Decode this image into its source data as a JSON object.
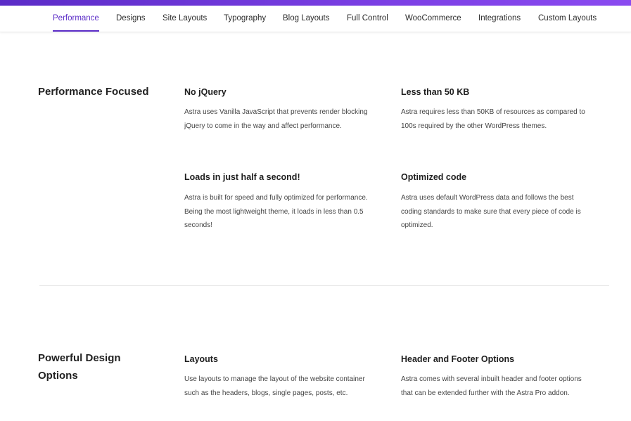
{
  "nav": {
    "tabs": [
      {
        "label": "Performance",
        "active": true
      },
      {
        "label": "Designs"
      },
      {
        "label": "Site Layouts"
      },
      {
        "label": "Typography"
      },
      {
        "label": "Blog Layouts"
      },
      {
        "label": "Full Control"
      },
      {
        "label": "WooCommerce"
      },
      {
        "label": "Integrations"
      },
      {
        "label": "Custom Layouts"
      }
    ]
  },
  "sections": [
    {
      "title": "Performance Focused",
      "features": [
        {
          "title": "No jQuery",
          "desc": "Astra uses Vanilla JavaScript that prevents render blocking jQuery to come in the way and affect performance."
        },
        {
          "title": "Less than 50 KB",
          "desc": "Astra requires less than 50KB of resources as compared to 100s required by the other WordPress themes."
        },
        {
          "title": "Loads in just half a second!",
          "desc": "Astra is built for speed and fully optimized for performance. Being the most lightweight theme, it loads in less than 0.5 seconds!"
        },
        {
          "title": "Optimized code",
          "desc": "Astra uses default WordPress data and follows the best coding standards to make sure that every piece of code is optimized."
        }
      ]
    },
    {
      "title": "Powerful Design Options",
      "features": [
        {
          "title": "Layouts",
          "desc": "Use layouts to manage the layout of the website container such as the headers, blogs, single pages, posts, etc."
        },
        {
          "title": "Header and Footer Options",
          "desc": "Astra comes with several inbuilt header and footer options that can be extended further with the Astra Pro addon."
        }
      ]
    }
  ],
  "colors": {
    "accent": "#5b2cc7",
    "text": "#3a3a3a",
    "heading": "#222222"
  }
}
